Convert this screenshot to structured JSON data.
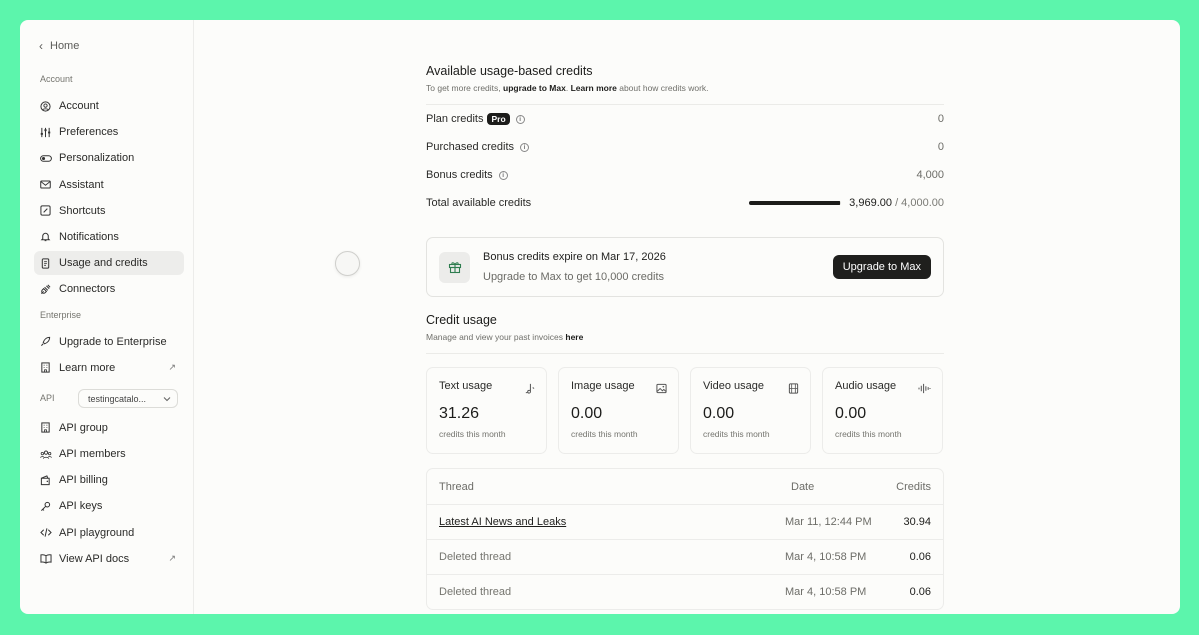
{
  "sidebar": {
    "home_label": "Home",
    "account_section": "Account",
    "account_items": [
      {
        "label": "Account",
        "icon": "user-circle-icon"
      },
      {
        "label": "Preferences",
        "icon": "sliders-icon"
      },
      {
        "label": "Personalization",
        "icon": "toggle-icon"
      },
      {
        "label": "Assistant",
        "icon": "mail-icon"
      },
      {
        "label": "Shortcuts",
        "icon": "shortcut-icon"
      },
      {
        "label": "Notifications",
        "icon": "bell-icon"
      },
      {
        "label": "Usage and credits",
        "icon": "receipt-icon",
        "active": true
      },
      {
        "label": "Connectors",
        "icon": "plug-icon"
      }
    ],
    "enterprise_section": "Enterprise",
    "enterprise_items": [
      {
        "label": "Upgrade to Enterprise",
        "icon": "rocket-icon"
      },
      {
        "label": "Learn more",
        "icon": "building-icon",
        "external": "↗"
      }
    ],
    "api_section": "API",
    "api_select_value": "testingcatalo...",
    "api_items": [
      {
        "label": "API group",
        "icon": "building-icon"
      },
      {
        "label": "API members",
        "icon": "users-icon"
      },
      {
        "label": "API billing",
        "icon": "wallet-icon"
      },
      {
        "label": "API keys",
        "icon": "key-icon"
      },
      {
        "label": "API playground",
        "icon": "code-icon"
      },
      {
        "label": "View API docs",
        "icon": "book-icon",
        "external": "↗"
      }
    ]
  },
  "credits": {
    "title": "Available usage-based credits",
    "sub_prefix": "To get more credits, ",
    "sub_link1": "upgrade to Max",
    "sub_mid": ". ",
    "sub_link2": "Learn more",
    "sub_suffix": " about how credits work.",
    "plan_label": "Plan credits",
    "plan_badge": "Pro",
    "plan_value": "0",
    "purchased_label": "Purchased credits",
    "purchased_value": "0",
    "bonus_label": "Bonus credits",
    "bonus_value": "4,000",
    "total_label": "Total available credits",
    "total_used": "3,969.00",
    "total_limit": "/ 4,000.00",
    "total_fraction": 0.99225
  },
  "promo": {
    "title": "Bonus credits expire on Mar 17, 2026",
    "subtitle": "Upgrade to Max to get 10,000 credits",
    "button": "Upgrade to Max"
  },
  "usage": {
    "title": "Credit usage",
    "sub_prefix": "Manage and view your past invoices ",
    "sub_link": "here",
    "cards": [
      {
        "title": "Text usage",
        "value": "31.26",
        "caption": "credits this month",
        "icon": "text-usage-icon"
      },
      {
        "title": "Image usage",
        "value": "0.00",
        "caption": "credits this month",
        "icon": "image-icon"
      },
      {
        "title": "Video usage",
        "value": "0.00",
        "caption": "credits this month",
        "icon": "film-icon"
      },
      {
        "title": "Audio usage",
        "value": "0.00",
        "caption": "credits this month",
        "icon": "waveform-icon"
      }
    ]
  },
  "table": {
    "headers": {
      "thread": "Thread",
      "date": "Date",
      "credits": "Credits"
    },
    "rows": [
      {
        "thread": "Latest AI News and Leaks",
        "date": "Mar 11, 12:44 PM",
        "credits": "30.94"
      },
      {
        "thread": "Deleted thread",
        "date": "Mar 4, 10:58 PM",
        "credits": "0.06"
      },
      {
        "thread": "Deleted thread",
        "date": "Mar 4, 10:58 PM",
        "credits": "0.06"
      }
    ]
  }
}
